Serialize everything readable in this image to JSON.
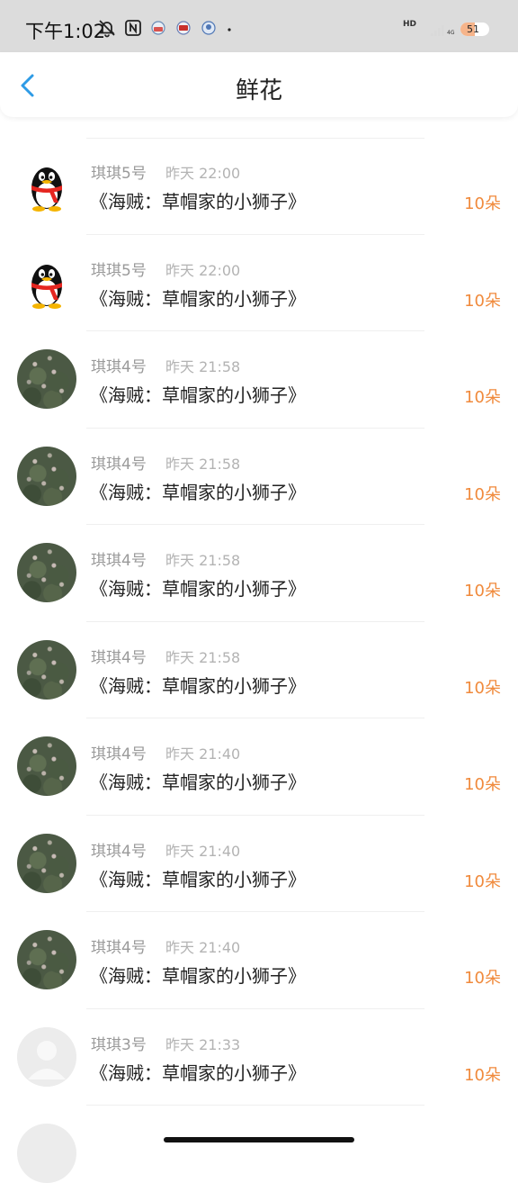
{
  "status_bar": {
    "time": "下午1:02",
    "hd": "HD",
    "signal": "4G",
    "battery": "51",
    "battery_level": 0.51
  },
  "header": {
    "title": "鲜花",
    "back_icon": "chevron-left-icon"
  },
  "colors": {
    "accent": "#2e9be6",
    "amount": "#f08a3c"
  },
  "gifts": [
    {
      "avatar": "qq-penguin",
      "user": "琪琪5号",
      "time": "昨天 22:00",
      "title": "《海贼：草帽家的小狮子》",
      "amount": "10朵"
    },
    {
      "avatar": "qq-penguin",
      "user": "琪琪5号",
      "time": "昨天 22:00",
      "title": "《海贼：草帽家的小狮子》",
      "amount": "10朵"
    },
    {
      "avatar": "photo",
      "user": "琪琪4号",
      "time": "昨天 21:58",
      "title": "《海贼：草帽家的小狮子》",
      "amount": "10朵"
    },
    {
      "avatar": "photo",
      "user": "琪琪4号",
      "time": "昨天 21:58",
      "title": "《海贼：草帽家的小狮子》",
      "amount": "10朵"
    },
    {
      "avatar": "photo",
      "user": "琪琪4号",
      "time": "昨天 21:58",
      "title": "《海贼：草帽家的小狮子》",
      "amount": "10朵"
    },
    {
      "avatar": "photo",
      "user": "琪琪4号",
      "time": "昨天 21:58",
      "title": "《海贼：草帽家的小狮子》",
      "amount": "10朵"
    },
    {
      "avatar": "photo",
      "user": "琪琪4号",
      "time": "昨天 21:40",
      "title": "《海贼：草帽家的小狮子》",
      "amount": "10朵"
    },
    {
      "avatar": "photo",
      "user": "琪琪4号",
      "time": "昨天 21:40",
      "title": "《海贼：草帽家的小狮子》",
      "amount": "10朵"
    },
    {
      "avatar": "photo",
      "user": "琪琪4号",
      "time": "昨天 21:40",
      "title": "《海贼：草帽家的小狮子》",
      "amount": "10朵"
    },
    {
      "avatar": "default",
      "user": "琪琪3号",
      "time": "昨天 21:33",
      "title": "《海贼：草帽家的小狮子》",
      "amount": "10朵"
    }
  ]
}
